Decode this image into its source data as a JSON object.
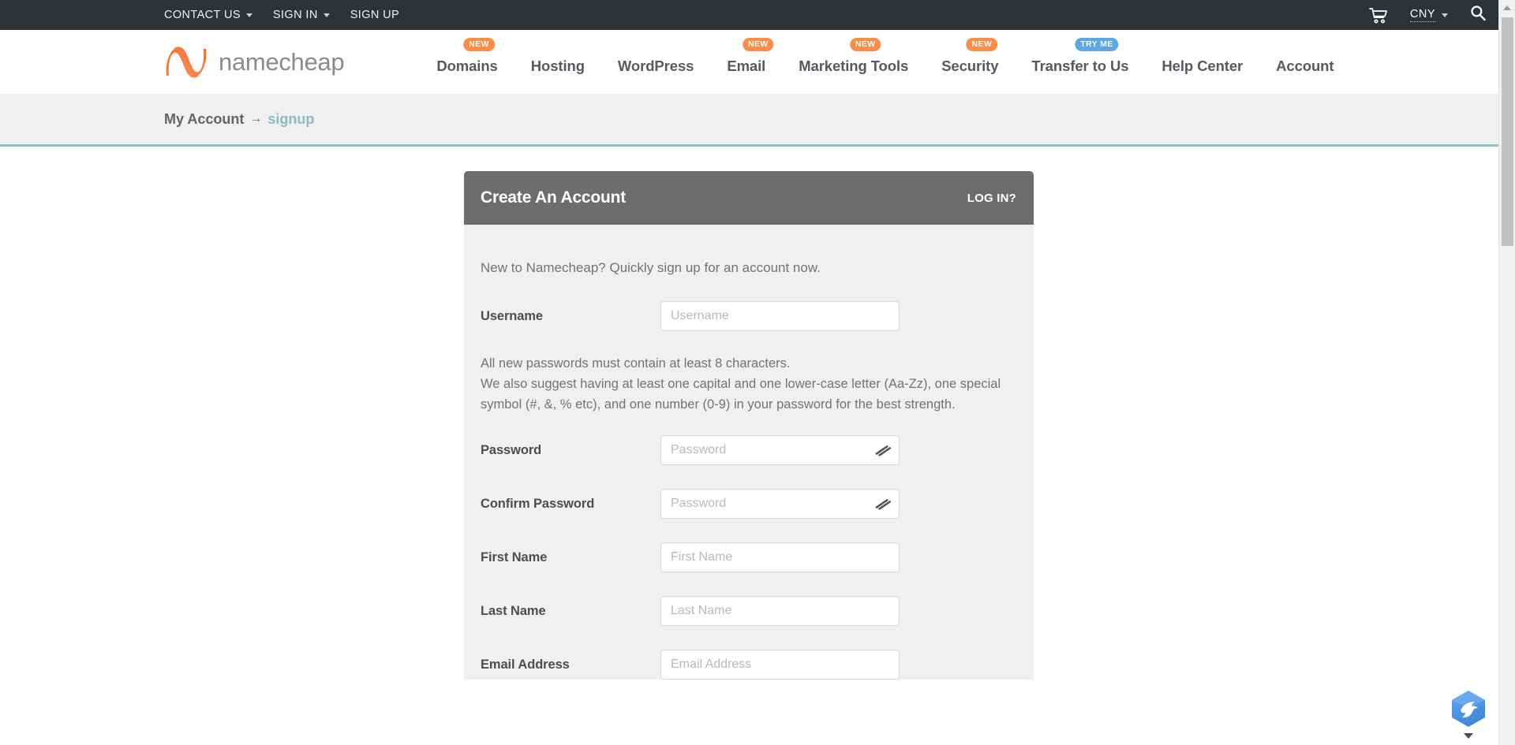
{
  "topbar": {
    "links": [
      {
        "label": "CONTACT US",
        "has_caret": true
      },
      {
        "label": "SIGN IN",
        "has_caret": true
      },
      {
        "label": "SIGN UP",
        "has_caret": false
      }
    ],
    "cart_icon": "shopping-cart-icon",
    "currency": "CNY",
    "search_icon": "search-icon"
  },
  "brand": {
    "name": "namecheap"
  },
  "nav": {
    "items": [
      {
        "label": "Domains",
        "badge": "NEW",
        "badge_type": "new"
      },
      {
        "label": "Hosting",
        "badge": "",
        "badge_type": ""
      },
      {
        "label": "WordPress",
        "badge": "",
        "badge_type": ""
      },
      {
        "label": "Email",
        "badge": "NEW",
        "badge_type": "new"
      },
      {
        "label": "Marketing Tools",
        "badge": "NEW",
        "badge_type": "new"
      },
      {
        "label": "Security",
        "badge": "NEW",
        "badge_type": "new"
      },
      {
        "label": "Transfer to Us",
        "badge": "TRY ME",
        "badge_type": "tryme"
      },
      {
        "label": "Help Center",
        "badge": "",
        "badge_type": ""
      },
      {
        "label": "Account",
        "badge": "",
        "badge_type": ""
      }
    ]
  },
  "breadcrumb": {
    "root": "My Account",
    "arrow": "→",
    "current": "signup"
  },
  "card": {
    "title": "Create An Account",
    "login_link": "LOG IN?",
    "intro": "New to Namecheap? Quickly sign up for an account now.",
    "password_note_line1": "All new passwords must contain at least 8 characters.",
    "password_note_line2": "We also suggest having at least one capital and one lower-case letter (Aa-Zz), one special symbol (#, &, % etc), and one number (0-9) in your password for the best strength.",
    "fields": [
      {
        "label": "Username",
        "placeholder": "Username",
        "type": "text",
        "toggle": false,
        "name": "username"
      },
      {
        "label": "Password",
        "placeholder": "Password",
        "type": "password",
        "toggle": true,
        "name": "password"
      },
      {
        "label": "Confirm Password",
        "placeholder": "Password",
        "type": "password",
        "toggle": true,
        "name": "confirm-password"
      },
      {
        "label": "First Name",
        "placeholder": "First Name",
        "type": "text",
        "toggle": false,
        "name": "first-name"
      },
      {
        "label": "Last Name",
        "placeholder": "Last Name",
        "type": "text",
        "toggle": false,
        "name": "last-name"
      },
      {
        "label": "Email Address",
        "placeholder": "Email Address",
        "type": "text",
        "toggle": false,
        "name": "email-address"
      }
    ],
    "password_toggle_icon": "eye-slash-icon"
  },
  "support_widget": {
    "icon": "bird-badge-icon"
  },
  "colors": {
    "topbar_bg": "#2e3336",
    "brand_orange": "#ff8c44",
    "badge_blue": "#5aa8e8",
    "teal_rule": "#92c2c2",
    "card_header": "#6d6d6d",
    "card_body": "#f0f0f0"
  }
}
